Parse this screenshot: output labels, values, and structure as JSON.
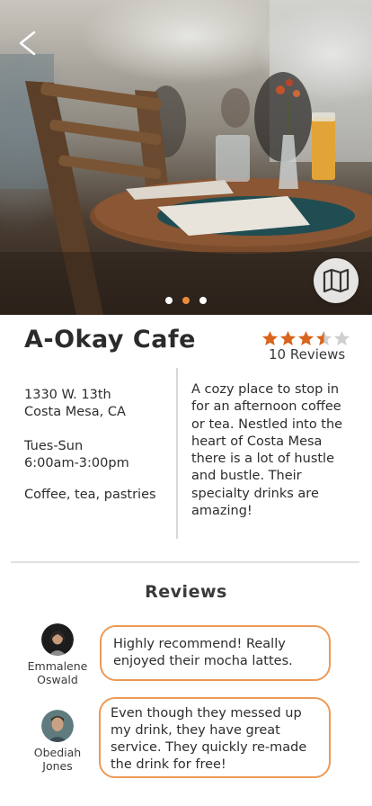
{
  "hero": {
    "back_icon": "chevron-left-icon",
    "map_icon": "folded-map-icon",
    "carousel_total": 3,
    "carousel_active_index": 1,
    "colors": {
      "accent": "#ea8a3e"
    }
  },
  "cafe": {
    "name": "A-Okay Cafe",
    "rating": 3.5,
    "rating_max": 5,
    "reviews_label": "10 Reviews",
    "address_line1": "1330 W. 13th",
    "address_line2": "Costa Mesa, CA",
    "days": "Tues-Sun",
    "hours": "6:00am-3:00pm",
    "offerings": "Coffee, tea, pastries",
    "description": "A cozy place to stop in for an afternoon coffee or tea. Nestled into the heart of Costa Mesa there is a lot of hustle and bustle. Their specialty drinks are amazing!"
  },
  "reviews": {
    "title": "Reviews",
    "items": [
      {
        "first_name": "Emmalene",
        "last_name": "Oswald",
        "text": "Highly recommend! Really enjoyed their mocha lattes."
      },
      {
        "first_name": "Obediah",
        "last_name": "Jones",
        "text": "Even though they messed up my drink, they have great service. They quickly re-made the drink for free!"
      }
    ]
  },
  "colors": {
    "star_filled": "#d9641c",
    "star_empty": "#cfcfcf",
    "bubble_border": "#ec9a56"
  }
}
